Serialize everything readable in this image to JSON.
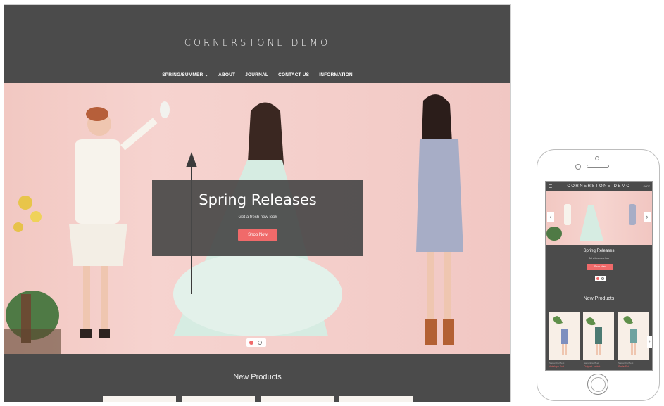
{
  "desktop": {
    "logo": "CORNERSTONE DEMO",
    "nav": [
      {
        "label": "SPRING/SUMMER ⌄"
      },
      {
        "label": "ABOUT"
      },
      {
        "label": "JOURNAL"
      },
      {
        "label": "CONTACT US"
      },
      {
        "label": "INFORMATION"
      }
    ],
    "hero": {
      "title": "Spring Releases",
      "subtitle": "Get a fresh new look",
      "button": "Shop Now"
    },
    "new_products_title": "New Products"
  },
  "mobile": {
    "menu_icon": "hamburger-icon",
    "logo": "CORNERSTONE DEMO",
    "cart": "CART",
    "hero": {
      "title": "Spring Releases",
      "subtitle": "Get a fresh new look",
      "button": "Shop Now"
    },
    "new_products_title": "New Products",
    "products": [
      {
        "brand": "Samantha Pleet",
        "name": "Antelope Suit"
      },
      {
        "brand": "Samantha Pleet",
        "name": "Outpost Jacket"
      },
      {
        "brand": "Samantha Pleet",
        "name": "Smile Suit"
      }
    ]
  },
  "colors": {
    "bg_dark": "#4b4b4b",
    "accent": "#f06a6a",
    "hero_pink": "#f4cfcb"
  }
}
